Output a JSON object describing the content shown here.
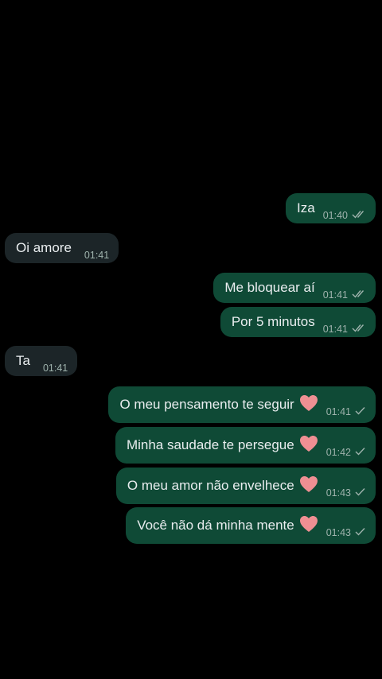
{
  "colors": {
    "background": "#000000",
    "outgoing_bubble": "#0f4a36",
    "incoming_bubble": "#1c2528",
    "text": "#e9edef",
    "meta": "#9fb3ad"
  },
  "messages": [
    {
      "direction": "outgoing",
      "text": "Iza",
      "time": "01:40",
      "status": "read-double-check-icon",
      "heart": false
    },
    {
      "direction": "incoming",
      "text": "Oi amore",
      "time": "01:41",
      "heart": false
    },
    {
      "direction": "outgoing",
      "text": "Me bloquear aí",
      "time": "01:41",
      "status": "read-double-check-icon",
      "heart": false
    },
    {
      "direction": "outgoing",
      "text": "Por 5 minutos",
      "time": "01:41",
      "status": "read-double-check-icon",
      "heart": false
    },
    {
      "direction": "incoming",
      "text": "Ta",
      "time": "01:41",
      "heart": false
    },
    {
      "direction": "outgoing",
      "text": "O meu pensamento te seguir",
      "time": "01:41",
      "status": "sent-check-icon",
      "heart": true
    },
    {
      "direction": "outgoing",
      "text": "Minha saudade te persegue",
      "time": "01:42",
      "status": "sent-check-icon",
      "heart": true
    },
    {
      "direction": "outgoing",
      "text": "O meu amor não envelhece",
      "time": "01:43",
      "status": "sent-check-icon",
      "heart": true
    },
    {
      "direction": "outgoing",
      "text": "Você não dá minha mente",
      "time": "01:43",
      "status": "sent-check-icon",
      "heart": true
    }
  ]
}
